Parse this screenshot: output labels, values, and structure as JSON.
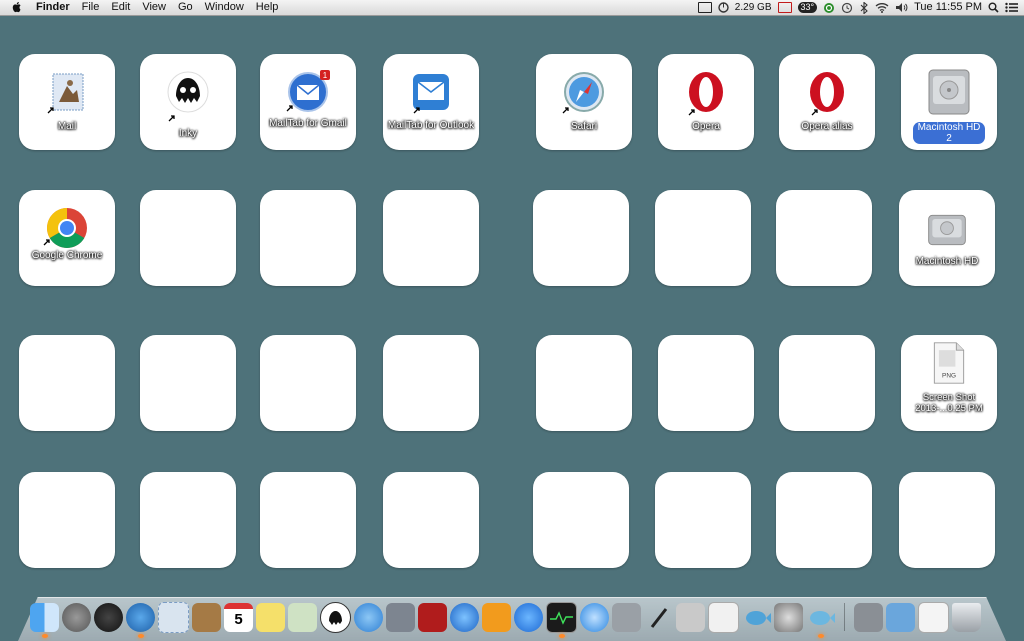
{
  "menubar": {
    "app_name": "Finder",
    "menus": [
      "File",
      "Edit",
      "View",
      "Go",
      "Window",
      "Help"
    ],
    "memory": "2.29 GB",
    "badge": "33°",
    "datetime": "Tue 11:55 PM"
  },
  "desktop": {
    "tiles": [
      {
        "label": "Mail",
        "icon": "mail-stamp-icon"
      },
      {
        "label": "Inky",
        "icon": "inky-octopus-icon"
      },
      {
        "label": "MailTab for Gmail",
        "icon": "mailtab-gmail-icon",
        "notif": "1"
      },
      {
        "label": "MailTab for Outlook",
        "icon": "mailtab-outlook-icon"
      },
      {
        "label": "Safari",
        "icon": "safari-compass-icon"
      },
      {
        "label": "Opera",
        "icon": "opera-icon"
      },
      {
        "label": "Opera alias",
        "icon": "opera-icon"
      },
      {
        "label": "Macintosh HD 2",
        "icon": "hard-drive-icon",
        "selected": true
      },
      {
        "label": "Google Chrome",
        "icon": "chrome-icon"
      },
      {
        "label": "Macintosh HD",
        "icon": "hard-drive-icon"
      },
      {
        "label": "Screen Shot 2013-...0.25 PM",
        "icon": "png-file-icon",
        "sublabel": "PNG"
      }
    ]
  },
  "dock": {
    "items": [
      "finder-icon",
      "launchpad-icon",
      "dashboard-icon",
      "safari-icon",
      "mail-icon",
      "contacts-icon",
      "calendar-icon",
      "notes-icon",
      "preview-icon",
      "inky-icon",
      "messages-icon",
      "facetime-icon",
      "photo-booth-icon",
      "itunes-icon",
      "ibooks-icon",
      "app-store-icon",
      "activity-monitor-icon",
      "music-icon",
      "disk-utility-icon",
      "pen-icon",
      "font-book-icon",
      "textedit-icon",
      "fish-icon",
      "system-preferences-icon",
      "fish2-icon",
      "drive-icon",
      "folder-icon",
      "document-icon",
      "trash-icon"
    ],
    "calendar_day": "5"
  }
}
